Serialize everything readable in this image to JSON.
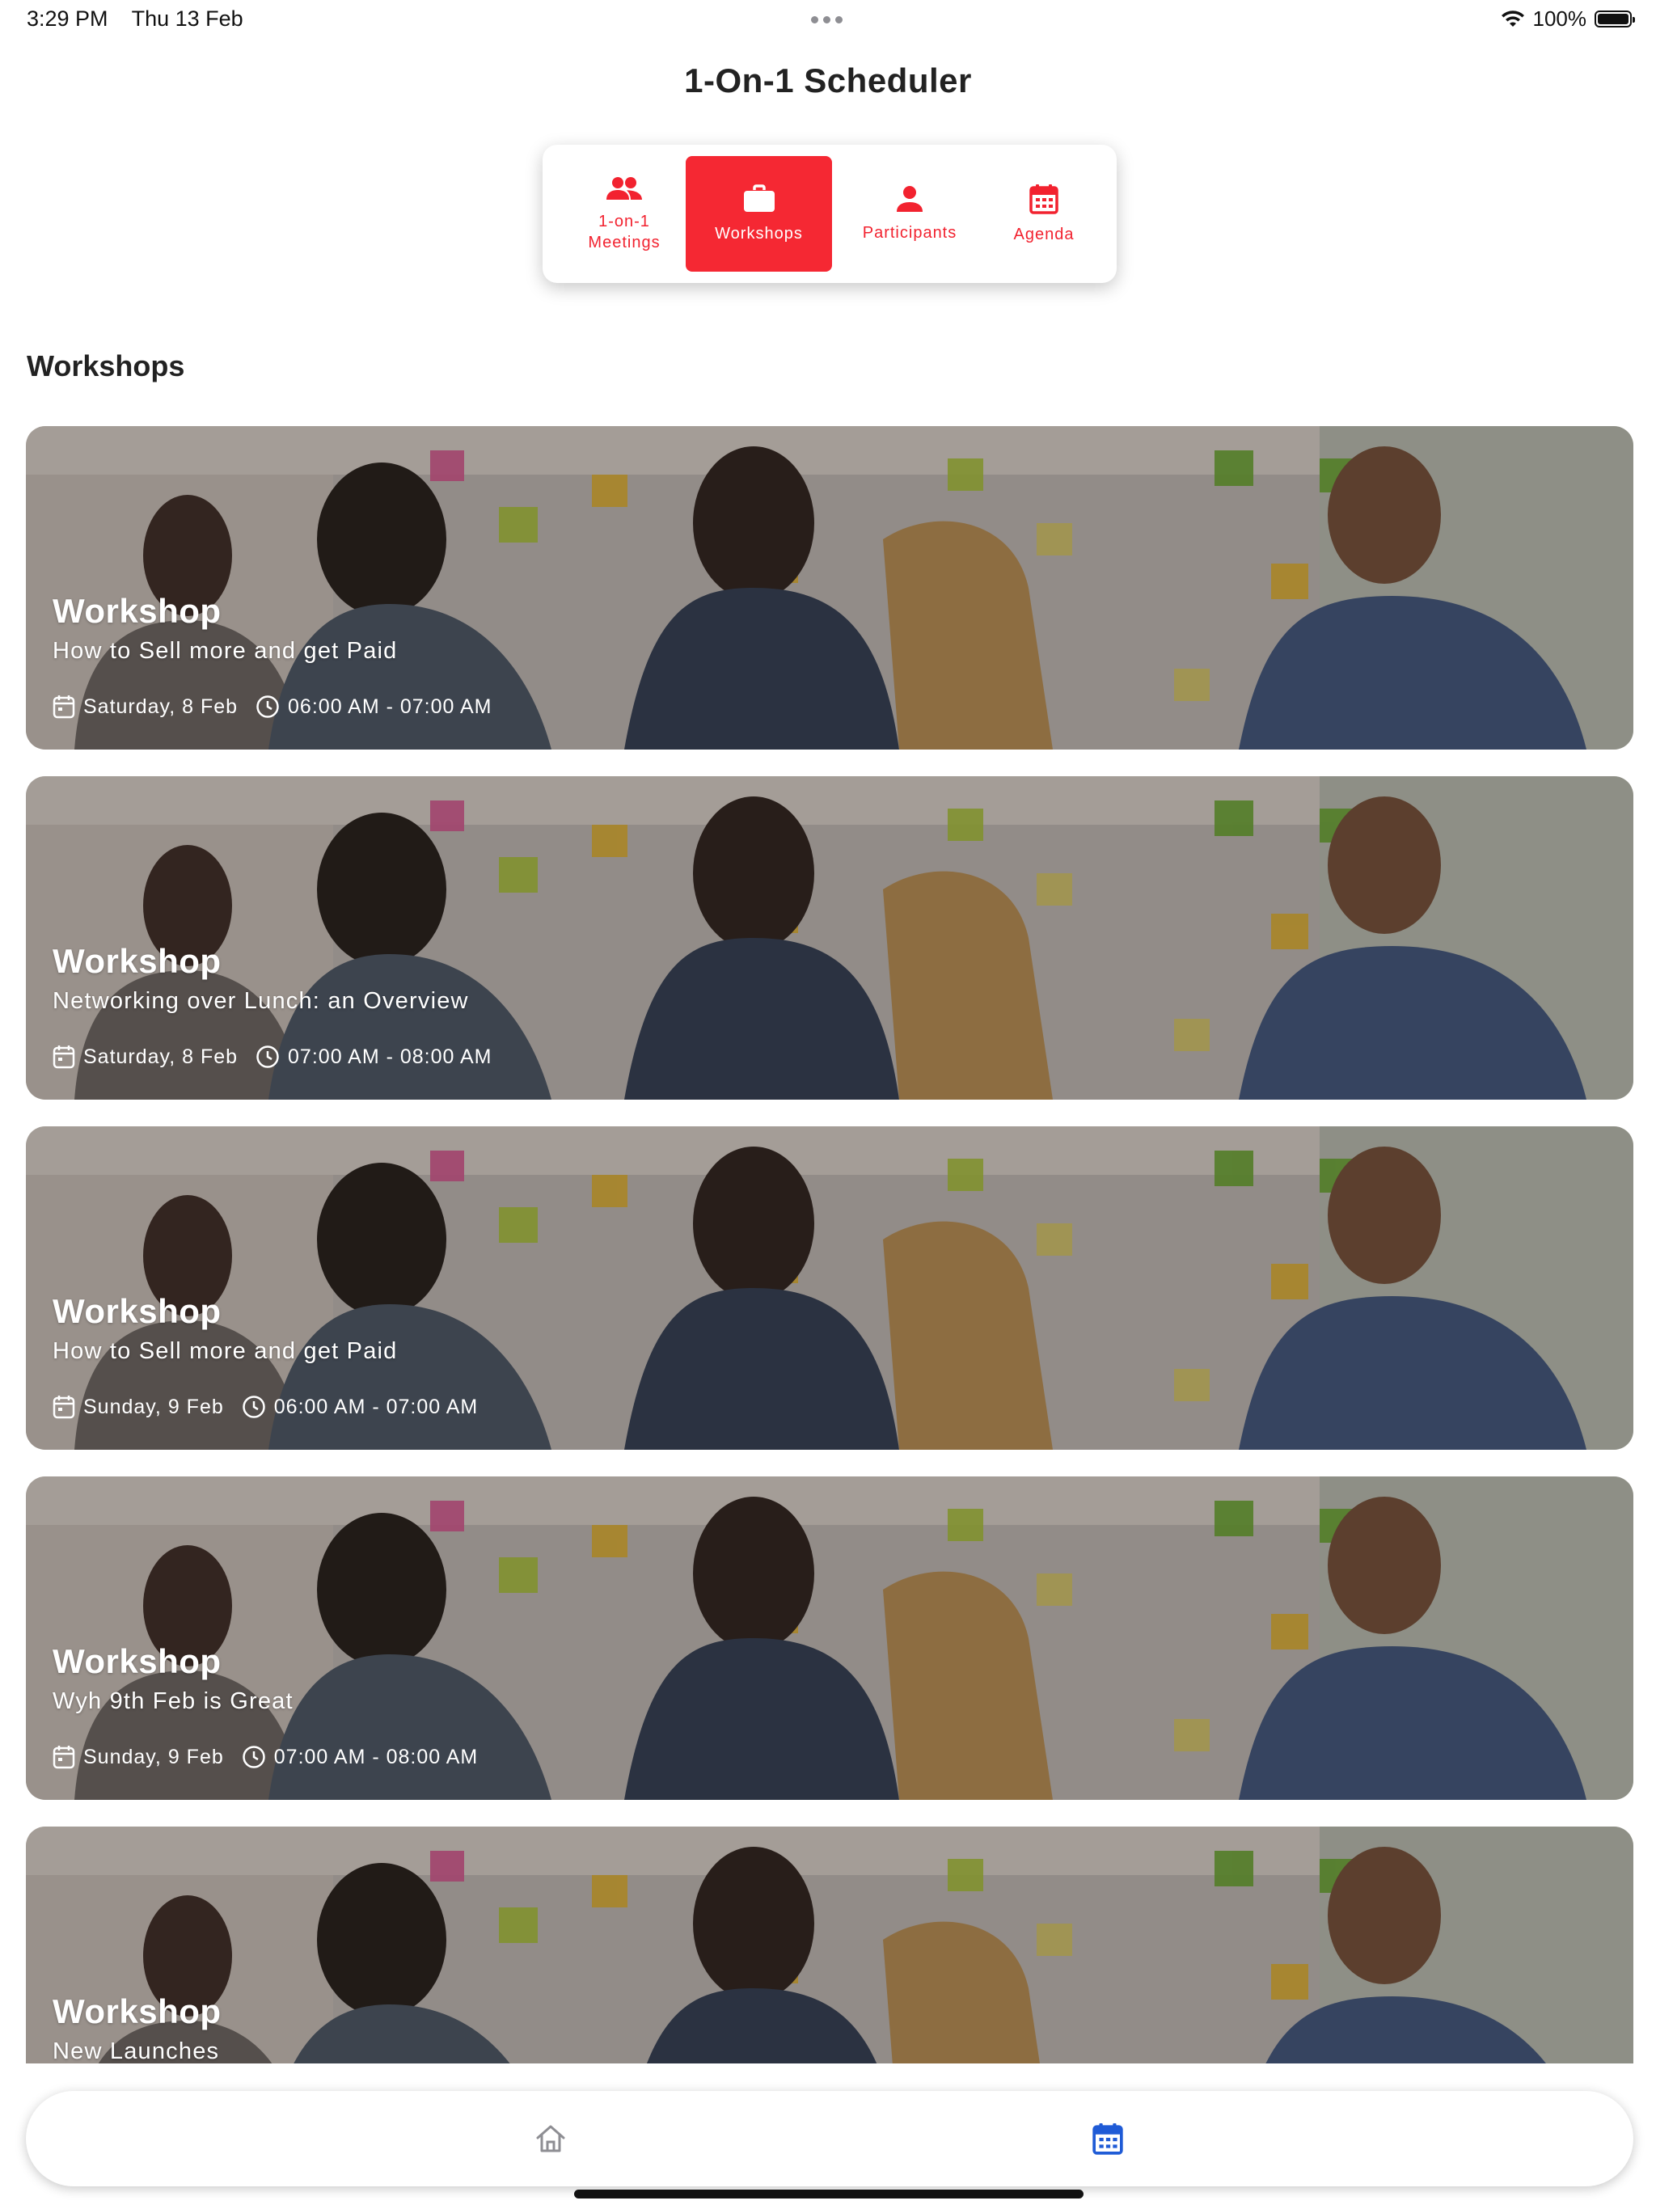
{
  "status_bar": {
    "time": "3:29 PM",
    "date": "Thu 13 Feb",
    "battery": "100%"
  },
  "app_title": "1-On-1 Scheduler",
  "segment": {
    "items": [
      {
        "label": "1-on-1\nMeetings",
        "icon": "people-icon"
      },
      {
        "label": "Workshops",
        "icon": "briefcase-icon",
        "active": true
      },
      {
        "label": "Participants",
        "icon": "person-icon"
      },
      {
        "label": "Agenda",
        "icon": "calendar-icon"
      }
    ],
    "accent_color": "#f52833"
  },
  "section_heading": "Workshops",
  "workshops": [
    {
      "title": "Workshop",
      "subtitle": "How to Sell more and get Paid",
      "date": "Saturday, 8 Feb",
      "time": "06:00 AM - 07:00 AM"
    },
    {
      "title": "Workshop",
      "subtitle": "Networking over Lunch: an Overview",
      "date": "Saturday, 8 Feb",
      "time": "07:00 AM - 08:00 AM"
    },
    {
      "title": "Workshop",
      "subtitle": "How to Sell more and get Paid",
      "date": "Sunday, 9 Feb",
      "time": "06:00 AM - 07:00 AM"
    },
    {
      "title": "Workshop",
      "subtitle": "Wyh 9th Feb is Great",
      "date": "Sunday, 9 Feb",
      "time": "07:00 AM - 08:00 AM"
    },
    {
      "title": "Workshop",
      "subtitle": "New Launches",
      "date": "",
      "time": ""
    }
  ],
  "tab_bar": {
    "tabs": [
      {
        "icon": "home-icon",
        "active": false
      },
      {
        "icon": "calendar-icon",
        "active": true
      }
    ],
    "active_color": "#1f5bd6",
    "inactive_color": "#8e8e93"
  }
}
